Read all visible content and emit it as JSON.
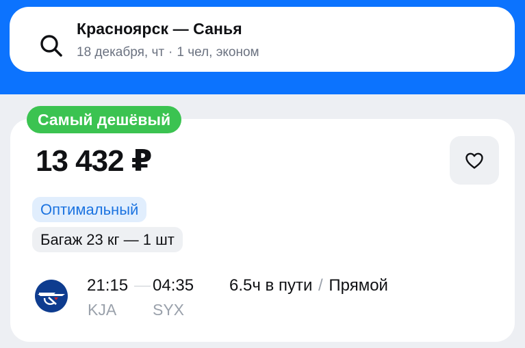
{
  "colors": {
    "brand_blue": "#0C73FE",
    "badge_green": "#3BC351",
    "tag_blue_bg": "#E1EEFD",
    "tag_blue_text": "#1B73E0",
    "muted_text": "#9AA1AB"
  },
  "search": {
    "route": "Красноярск — Санья",
    "date": "18 декабря, чт",
    "separator": "·",
    "passengers": "1 чел, эконом",
    "icon": "search-icon"
  },
  "ticket": {
    "badge": "Самый дешёвый",
    "price": "13 432 ₽",
    "favorite_icon": "heart-icon",
    "tags": {
      "optimal": "Оптимальный",
      "baggage": "Багаж 23 кг — 1 шт"
    },
    "airline_icon": "airline-logo-icon",
    "flight": {
      "departure_time": "21:15",
      "arrival_time": "04:35",
      "departure_code": "KJA",
      "arrival_code": "SYX",
      "duration": "6.5ч в пути",
      "slash": "/",
      "type": "Прямой"
    }
  }
}
